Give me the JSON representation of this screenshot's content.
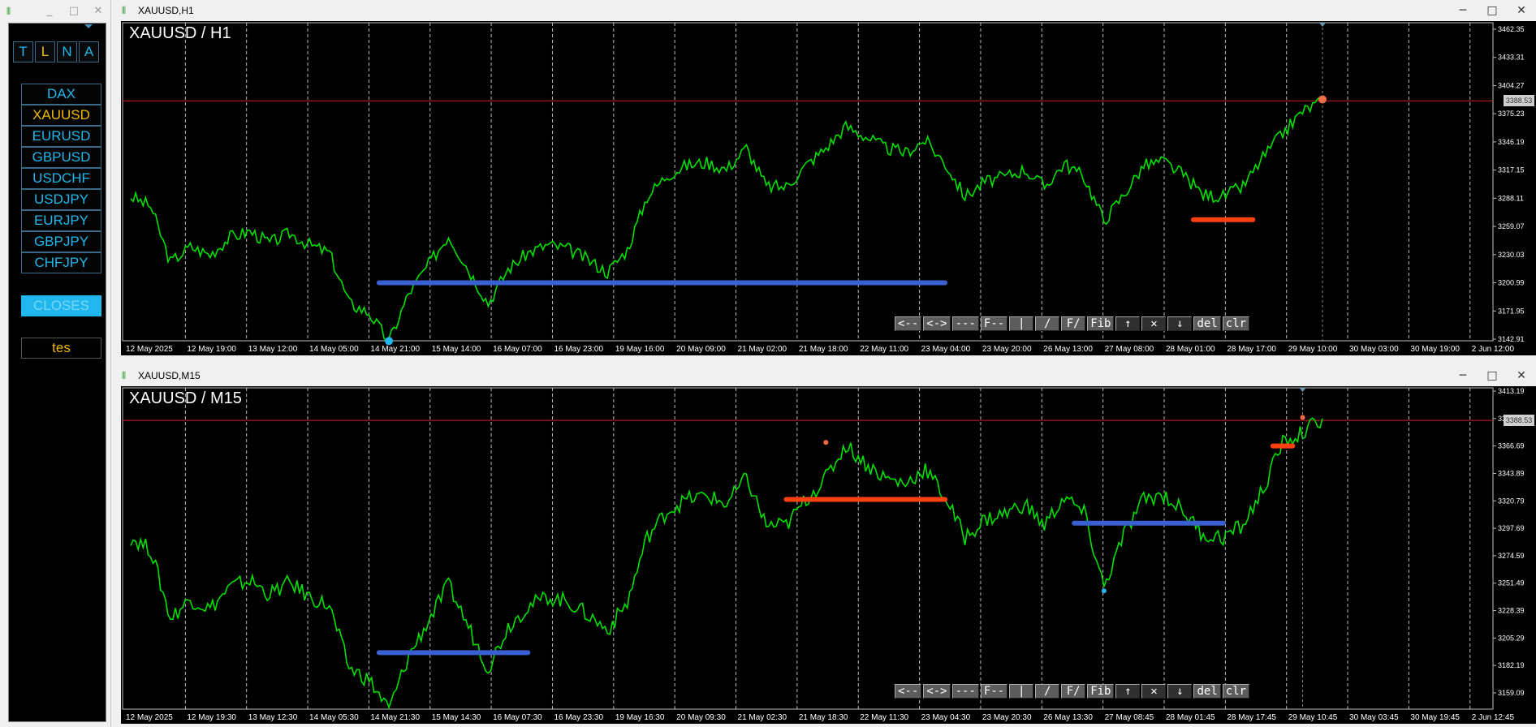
{
  "left_window": {
    "title": "",
    "controls": [
      "_",
      "□",
      "✕"
    ],
    "mode_buttons": [
      {
        "label": "T",
        "selected": false
      },
      {
        "label": "L",
        "selected": true
      },
      {
        "label": "N",
        "selected": false
      },
      {
        "label": "A",
        "selected": false
      }
    ],
    "symbols": [
      {
        "label": "DAX",
        "active": false
      },
      {
        "label": "XAUUSD",
        "active": true
      },
      {
        "label": "EURUSD",
        "active": false
      },
      {
        "label": "GBPUSD",
        "active": false
      },
      {
        "label": "USDCHF",
        "active": false
      },
      {
        "label": "USDJPY",
        "active": false
      },
      {
        "label": "EURJPY",
        "active": false
      },
      {
        "label": "GBPJPY",
        "active": false
      },
      {
        "label": "CHFJPY",
        "active": false
      }
    ],
    "closes_label": "CLOSES",
    "tes_label": "tes"
  },
  "charts": [
    {
      "window_title": "XAUUSD,H1",
      "label": "XAUUSD / H1",
      "controls": [
        "─",
        "□",
        "✕"
      ],
      "price_ticks": [
        "3462.35",
        "3433.31",
        "3404.27",
        "3375.23",
        "3346.19",
        "3317.15",
        "3288.11",
        "3259.07",
        "3230.03",
        "3200.99",
        "3171.95",
        "3142.91"
      ],
      "current_price": "3388.53",
      "time_ticks": [
        "12 May 2025",
        "12 May 19:00",
        "13 May 12:00",
        "14 May 05:00",
        "14 May 21:00",
        "15 May 14:00",
        "16 May 07:00",
        "16 May 23:00",
        "19 May 16:00",
        "20 May 09:00",
        "21 May 02:00",
        "21 May 18:00",
        "22 May 11:00",
        "23 May 04:00",
        "23 May 20:00",
        "26 May 13:00",
        "27 May 08:00",
        "28 May 01:00",
        "28 May 17:00",
        "29 May 10:00",
        "30 May 03:00",
        "30 May 19:00",
        "2 Jun 12:00"
      ],
      "toolbar": [
        "<--",
        "<->",
        "---",
        "F--",
        "|",
        "/",
        "F/",
        "Fib",
        "↑",
        "✕",
        "↓",
        "del",
        "clr"
      ]
    },
    {
      "window_title": "XAUUSD,M15",
      "label": "XAUUSD / M15",
      "controls": [
        "─",
        "□",
        "✕"
      ],
      "price_ticks": [
        "3413.19",
        "3389.99",
        "3366.69",
        "3343.89",
        "3320.79",
        "3297.69",
        "3274.59",
        "3251.49",
        "3228.39",
        "3205.29",
        "3182.19",
        "3159.09"
      ],
      "current_price": "3388.53",
      "time_ticks": [
        "12 May 2025",
        "12 May 19:30",
        "13 May 12:30",
        "14 May 05:30",
        "14 May 21:30",
        "15 May 14:30",
        "16 May 07:30",
        "16 May 23:30",
        "19 May 16:30",
        "20 May 09:30",
        "21 May 02:30",
        "21 May 18:30",
        "22 May 11:30",
        "23 May 04:30",
        "23 May 20:30",
        "26 May 13:30",
        "27 May 08:45",
        "28 May 01:45",
        "28 May 17:45",
        "29 May 10:45",
        "30 May 03:45",
        "30 May 19:45",
        "2 Jun 12:45"
      ],
      "toolbar": [
        "<--",
        "<->",
        "---",
        "F--",
        "|",
        "/",
        "F/",
        "Fib",
        "↑",
        "✕",
        "↓",
        "del",
        "clr"
      ]
    }
  ],
  "colors": {
    "price_line": "#00e000",
    "support": "#3a5fd0",
    "resistance": "#ff4010",
    "current_line": "#d02020",
    "accent": "#1fb7ee",
    "active": "#f0b800"
  },
  "chart_data": [
    {
      "type": "line",
      "title": "XAUUSD / H1",
      "ylim": [
        3142.91,
        3462.35
      ],
      "series": [
        {
          "values": [
            3290,
            3280,
            3222,
            3238,
            3230,
            3248,
            3254,
            3242,
            3252,
            3240,
            3232,
            3180,
            3170,
            3140,
            3190,
            3220,
            3250,
            3215,
            3180,
            3215,
            3232,
            3240,
            3236,
            3225,
            3212,
            3235,
            3290,
            3312,
            3322,
            3325,
            3318,
            3340,
            3300,
            3300,
            3322,
            3340,
            3362,
            3352,
            3340,
            3335,
            3348,
            3324,
            3290,
            3305,
            3310,
            3318,
            3300,
            3324,
            3310,
            3265,
            3292,
            3322,
            3326,
            3312,
            3292,
            3290,
            3300,
            3330,
            3355,
            3378,
            3388
          ]
        }
      ],
      "hlines": [
        {
          "value": 3388.53,
          "label": "3388.53"
        }
      ]
    },
    {
      "type": "line",
      "title": "XAUUSD / M15",
      "ylim": [
        3159.09,
        3413.19
      ],
      "series": [
        {
          "values": [
            3290,
            3280,
            3222,
            3238,
            3230,
            3248,
            3254,
            3242,
            3252,
            3240,
            3232,
            3180,
            3170,
            3145,
            3190,
            3220,
            3250,
            3215,
            3180,
            3215,
            3232,
            3240,
            3236,
            3225,
            3212,
            3235,
            3290,
            3312,
            3322,
            3325,
            3318,
            3340,
            3300,
            3300,
            3322,
            3340,
            3368,
            3352,
            3340,
            3335,
            3348,
            3324,
            3290,
            3305,
            3310,
            3318,
            3300,
            3324,
            3310,
            3248,
            3292,
            3322,
            3326,
            3312,
            3292,
            3290,
            3300,
            3330,
            3370,
            3378,
            3390
          ]
        }
      ],
      "hlines": [
        {
          "value": 3388.53,
          "label": "3388.53"
        }
      ]
    }
  ]
}
